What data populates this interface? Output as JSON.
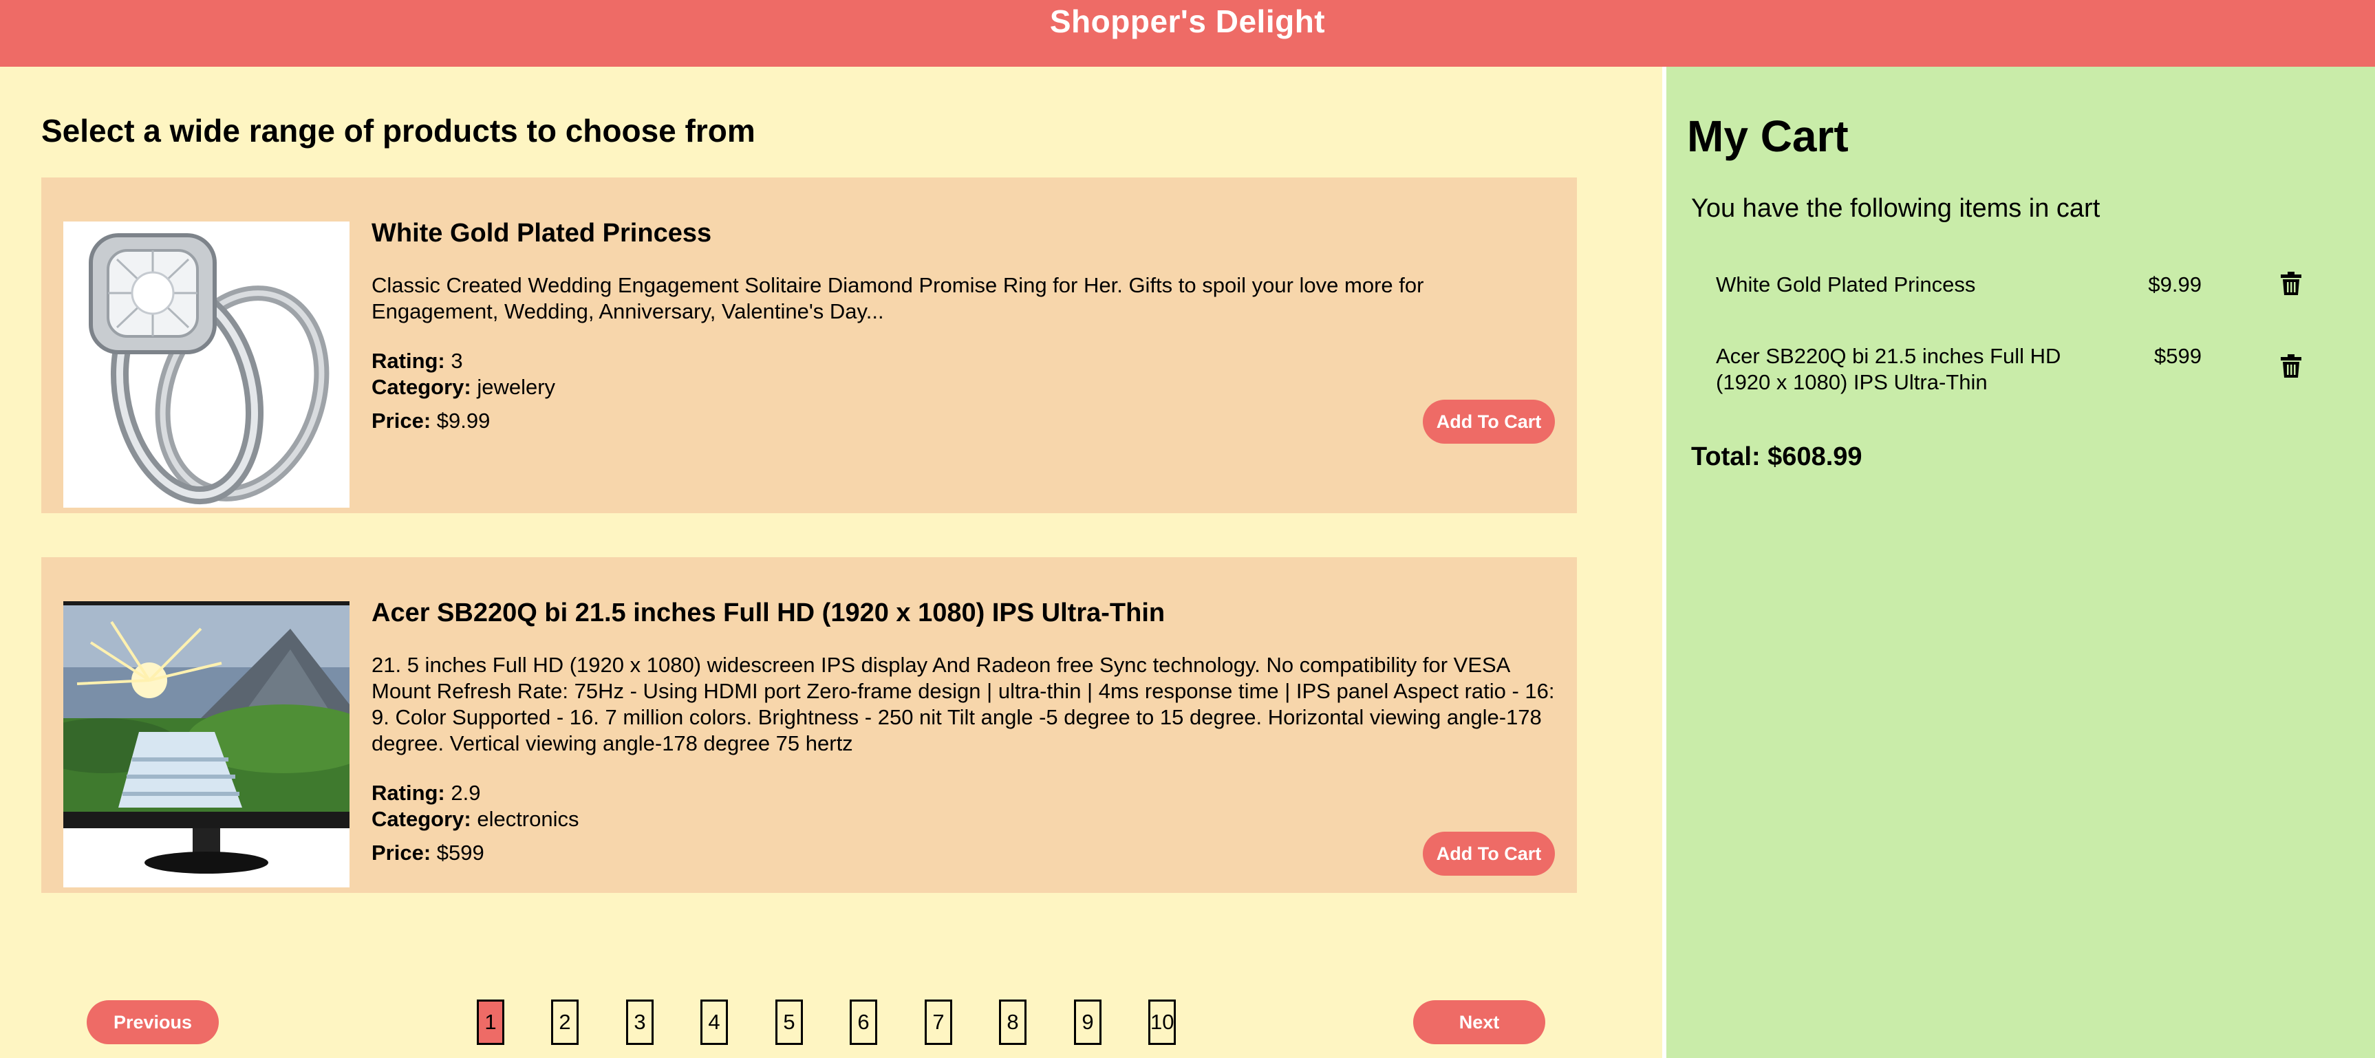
{
  "app": {
    "title": "Shopper's Delight"
  },
  "catalog": {
    "heading": "Select a wide range of products to choose from",
    "products": [
      {
        "title": "White Gold Plated Princess",
        "description": "Classic Created Wedding Engagement Solitaire Diamond Promise Ring for Her. Gifts to spoil your love more for Engagement, Wedding, Anniversary, Valentine's Day...",
        "rating_label": "Rating:",
        "rating": "3",
        "category_label": "Category:",
        "category": "jewelery",
        "price_label": "Price:",
        "price": "$9.99",
        "add_label": "Add To Cart",
        "image": "ring-image"
      },
      {
        "title": "Acer SB220Q bi 21.5 inches Full HD (1920 x 1080) IPS Ultra-Thin",
        "description": "21. 5 inches Full HD (1920 x 1080) widescreen IPS display And Radeon free Sync technology. No compatibility for VESA Mount Refresh Rate: 75Hz - Using HDMI port Zero-frame design | ultra-thin | 4ms response time | IPS panel Aspect ratio - 16: 9. Color Supported - 16. 7 million colors. Brightness - 250 nit Tilt angle -5 degree to 15 degree. Horizontal viewing angle-178 degree. Vertical viewing angle-178 degree 75 hertz",
        "rating_label": "Rating:",
        "rating": "2.9",
        "category_label": "Category:",
        "category": "electronics",
        "price_label": "Price:",
        "price": "$599",
        "add_label": "Add To Cart",
        "image": "monitor-image"
      }
    ]
  },
  "pagination": {
    "previous_label": "Previous",
    "next_label": "Next",
    "pages": [
      "1",
      "2",
      "3",
      "4",
      "5",
      "6",
      "7",
      "8",
      "9",
      "10"
    ],
    "current": "1"
  },
  "cart": {
    "title": "My Cart",
    "subtitle": "You have the following items in cart",
    "items": [
      {
        "name": "White Gold Plated Princess",
        "price": "$9.99"
      },
      {
        "name": "Acer SB220Q bi 21.5 inches Full HD (1920 x 1080) IPS Ultra-Thin",
        "price": "$599"
      }
    ],
    "remove_icon": "trash-icon",
    "total": "Total: $608.99"
  },
  "colors": {
    "header": "#ee6b66",
    "main_bg": "#fef5c2",
    "card_bg": "#f7d6ab",
    "cart_bg": "#c9eca9",
    "accent": "#ee6b66"
  }
}
